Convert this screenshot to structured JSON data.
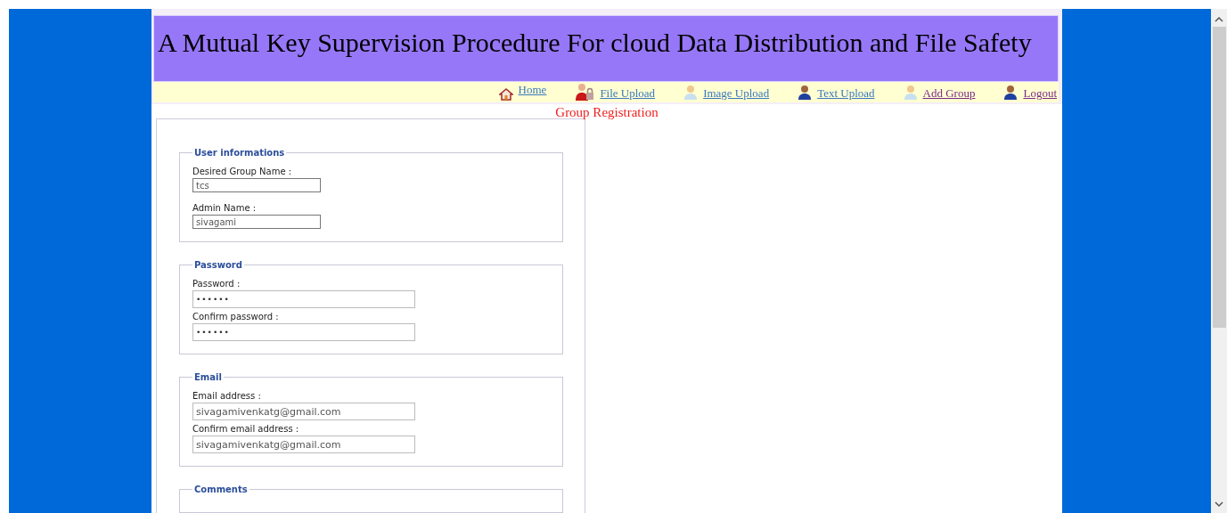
{
  "header": {
    "title": "A Mutual Key Supervision Procedure For cloud Data Distribution and File Safety"
  },
  "nav": [
    {
      "label": "Home",
      "visited": false
    },
    {
      "label": "File Upload",
      "visited": false
    },
    {
      "label": "Image Upload",
      "visited": false
    },
    {
      "label": "Text Upload",
      "visited": false
    },
    {
      "label": "Add Group",
      "visited": true
    },
    {
      "label": "Logout",
      "visited": true
    }
  ],
  "page_title": "Group Registration",
  "fieldsets": [
    {
      "legend": "User informations",
      "fields": [
        {
          "label": "Desired Group Name :",
          "value": "tcs",
          "kind": "short"
        },
        {
          "label": "Admin Name :",
          "value": "sivagami",
          "kind": "short"
        }
      ]
    },
    {
      "legend": "Password",
      "fields": [
        {
          "label": "Password :",
          "value": "••••••",
          "kind": "secret"
        },
        {
          "label": "Confirm password :",
          "value": "••••••",
          "kind": "secret"
        }
      ]
    },
    {
      "legend": "Email",
      "fields": [
        {
          "label": "Email address :",
          "value": "sivagamivenkatg@gmail.com",
          "kind": "wide"
        },
        {
          "label": "Confirm email address :",
          "value": "sivagamivenkatg@gmail.com",
          "kind": "wide"
        }
      ]
    },
    {
      "legend": "Comments"
    }
  ]
}
